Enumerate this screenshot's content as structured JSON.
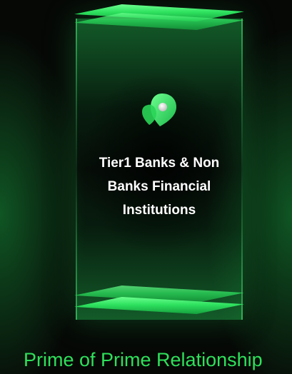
{
  "card": {
    "title": "Tier1 Banks & Non Banks Financial Institutions",
    "icon": "green-pin-logo-icon"
  },
  "footer": {
    "heading": "Prime of Prime Relationship"
  },
  "colors": {
    "background": "#060806",
    "accent_green": "#2ee05a",
    "glow_green": "#6dff8f",
    "text": "#ffffff"
  }
}
